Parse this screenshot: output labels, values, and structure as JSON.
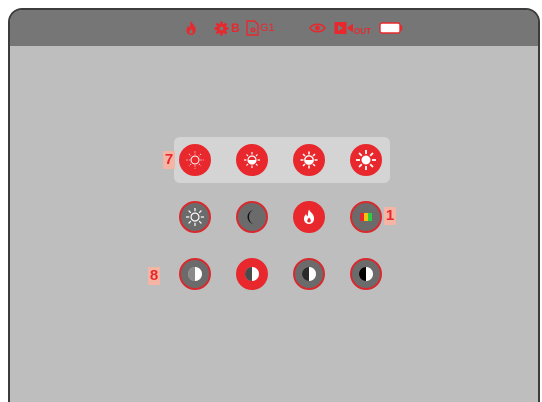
{
  "status_bar": {
    "icons": [
      "flame-icon",
      "gear-icon",
      "file-gear-icon",
      "eye-icon",
      "video-out-icon",
      "battery-icon"
    ],
    "wb_label": "B",
    "file_label": "G1",
    "video_out_label": "OUT"
  },
  "callouts": {
    "seven": "7",
    "one": "1",
    "eight": "8"
  },
  "colors": {
    "accent": "#e8282d",
    "screen_bg": "#bebebe",
    "topbar_bg": "#767676",
    "panel_bg": "#d4d4d4",
    "button_dark": "#6b6b6b",
    "callout_bg": "#f4b5a4"
  },
  "brightness_row": [
    "brightness-1-icon",
    "brightness-2-icon",
    "brightness-3-icon",
    "brightness-4-icon"
  ],
  "scene_row": [
    "brightness-auto-icon",
    "night-icon",
    "flame-icon",
    "color-palette-icon"
  ],
  "contrast_row": [
    "contrast-1-icon",
    "contrast-2-icon",
    "contrast-3-icon",
    "contrast-4-icon"
  ]
}
